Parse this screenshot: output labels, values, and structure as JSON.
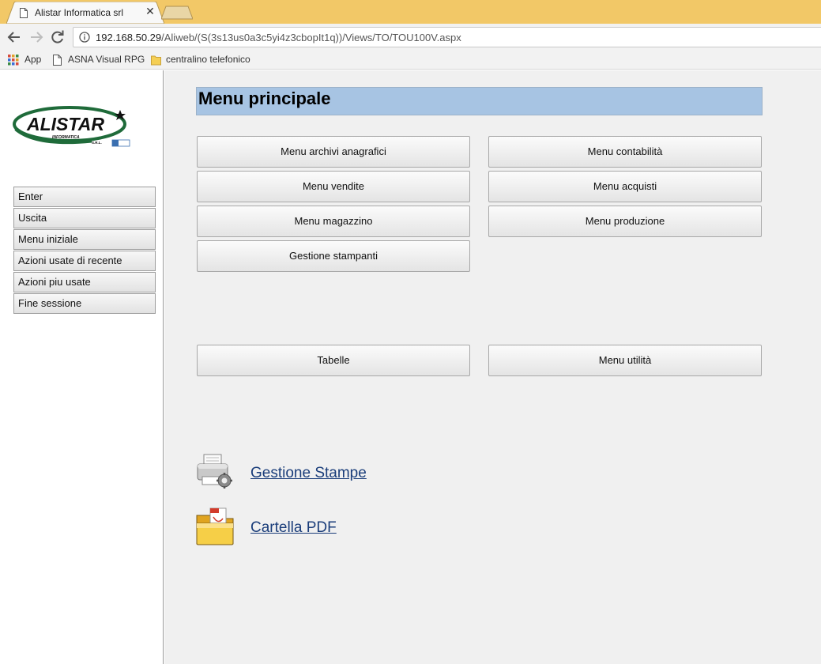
{
  "browser": {
    "tab_title": "Alistar Informatica srl",
    "tab_close": "✕",
    "url_host": "192.168.50.29",
    "url_path": "/Aliweb/(S(3s13us0a3c5yi4z3cbopIt1q))/Views/TO/TOU100V.aspx",
    "bookmarks": [
      {
        "label": "App",
        "icon": "apps-grid-icon"
      },
      {
        "label": "ASNA Visual RPG",
        "icon": "page-icon"
      },
      {
        "label": "centralino telefonico",
        "icon": "folder-icon"
      }
    ]
  },
  "logo": {
    "brand": "ALISTAR",
    "sub": "INFORMATICA",
    "suffix": "S.R.L."
  },
  "sidebar": {
    "items": [
      {
        "label": "Enter"
      },
      {
        "label": "Uscita"
      },
      {
        "label": "Menu iniziale"
      },
      {
        "label": "Azioni usate di recente"
      },
      {
        "label": "Azioni piu usate"
      },
      {
        "label": "Fine sessione"
      }
    ]
  },
  "main": {
    "title": "Menu principale",
    "buttons": {
      "archivi": "Menu archivi anagrafici",
      "contabilita": "Menu contabilità",
      "vendite": "Menu vendite",
      "acquisti": "Menu acquisti",
      "magazzino": "Menu magazzino",
      "produzione": "Menu produzione",
      "stampanti": "Gestione stampanti",
      "tabelle": "Tabelle",
      "utilita": "Menu utilità"
    },
    "links": {
      "gestione_stampe": "Gestione Stampe",
      "cartella_pdf": "Cartella PDF"
    }
  },
  "colors": {
    "tabstrip": "#f2c867",
    "title_bar": "#a7c4e3",
    "link": "#1a3d7a",
    "logo_green": "#1f6b3a"
  }
}
